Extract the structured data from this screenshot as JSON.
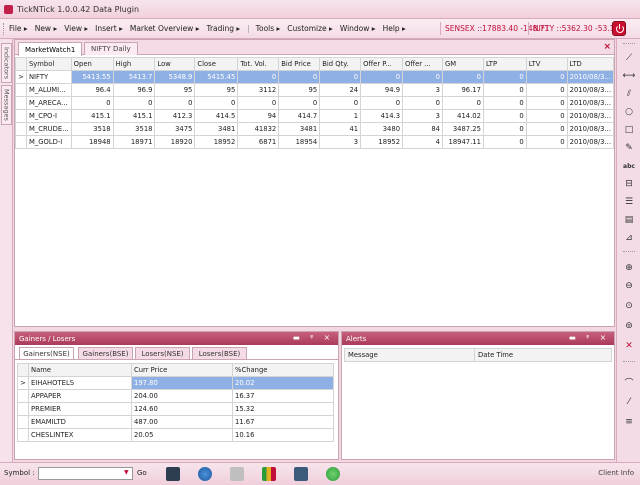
{
  "window": {
    "title": "TickNTick 1.0.0.42 Data Plugin"
  },
  "menu": {
    "items": [
      "File ▸",
      "New ▸",
      "View ▸",
      "Insert ▸",
      "Market Overview ▸",
      "Trading ▸",
      "|",
      "Tools ▸",
      "Customize ▸",
      "Window ▸",
      "Help ▸"
    ]
  },
  "ticker": {
    "sensex": "SENSEX ::17883.40 -148.71",
    "nifty": "NIFTY ::5362.30 -53.15"
  },
  "side_tabs": [
    "Indicators",
    "Messages"
  ],
  "watch": {
    "tabs": [
      "MarketWatch1",
      "NIFTY Daily"
    ],
    "close_icon": "×",
    "columns": [
      "Symbol",
      "Open",
      "High",
      "Low",
      "Close",
      "Tot. Vol.",
      "Bid Price",
      "Bid Qty.",
      "Offer P...",
      "Offer ...",
      "GM",
      "LTP",
      "LTV",
      "LTD"
    ],
    "rows": [
      [
        "NIFTY",
        "5413.55",
        "5413.7",
        "5348.9",
        "5415.45",
        "0",
        "0",
        "0",
        "0",
        "0",
        "0",
        "0",
        "0",
        "2010/08/3..."
      ],
      [
        "M_ALUMI...",
        "96.4",
        "96.9",
        "95",
        "95",
        "3112",
        "95",
        "24",
        "94.9",
        "3",
        "96.17",
        "0",
        "0",
        "2010/08/3..."
      ],
      [
        "M_ARECA...",
        "0",
        "0",
        "0",
        "0",
        "0",
        "0",
        "0",
        "0",
        "0",
        "0",
        "0",
        "0",
        "2010/08/3..."
      ],
      [
        "M_CPO-I",
        "415.1",
        "415.1",
        "412.3",
        "414.5",
        "94",
        "414.7",
        "1",
        "414.3",
        "3",
        "414.02",
        "0",
        "0",
        "2010/08/3..."
      ],
      [
        "M_CRUDE...",
        "3518",
        "3518",
        "3475",
        "3481",
        "41832",
        "3481",
        "41",
        "3480",
        "84",
        "3487.25",
        "0",
        "0",
        "2010/08/3..."
      ],
      [
        "M_GOLD-I",
        "18948",
        "18971",
        "18920",
        "18952",
        "6871",
        "18954",
        "3",
        "18952",
        "4",
        "18947.11",
        "0",
        "0",
        "2010/08/3..."
      ]
    ],
    "row_indicator": ">"
  },
  "gainers": {
    "title": "Gainers / Losers",
    "controls": "▬ ᵠ ×",
    "tabs": [
      "Gainers(NSE)",
      "Gainers(BSE)",
      "Losers(NSE)",
      "Losers(BSE)"
    ],
    "columns": [
      "Name",
      "Curr Price",
      "%Change"
    ],
    "rows": [
      [
        "EIHAHOTELS",
        "197.80",
        "20.02"
      ],
      [
        "APPAPER",
        "204.00",
        "16.37"
      ],
      [
        "PREMIER",
        "124.60",
        "15.32"
      ],
      [
        "EMAMILTD",
        "487.00",
        "11.67"
      ],
      [
        "CHESLINTEX",
        "20.05",
        "10.16"
      ]
    ]
  },
  "alerts": {
    "title": "Alerts",
    "controls": "▬ ᵠ ×",
    "columns": [
      "Message",
      "Date Time"
    ]
  },
  "statusbar": {
    "symbol_label": "Symbol :",
    "symbol_value": "",
    "go_label": "Go",
    "client_info": "Client Info"
  },
  "colors": {
    "accent": "#c0103a",
    "chrome": "#f3d7e2",
    "panel_header": "#b2496a",
    "selection": "#8fb0e4"
  },
  "icons": {
    "toolbar": [
      "line-icon",
      "arrow-icon",
      "fib-icon",
      "ellipse-icon",
      "rectangle-icon",
      "pencil-icon",
      "text-icon",
      "channel-icon",
      "gann-icon",
      "grid-icon",
      "fan-icon",
      "zoom-in-icon",
      "zoom-out-icon",
      "zoom-fit-icon",
      "zoom-reset-icon",
      "delete-icon",
      "crosshair-icon",
      "draw-icon",
      "menu-icon"
    ],
    "statusbar": [
      "chart-icon",
      "globe-icon",
      "calculator-icon",
      "bar-chart-icon",
      "scanner-icon",
      "refresh-icon"
    ]
  }
}
